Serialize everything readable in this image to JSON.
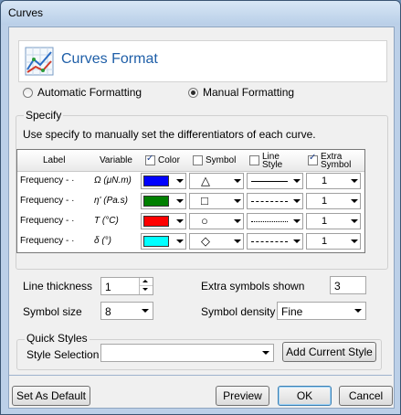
{
  "window": {
    "title": "Curves"
  },
  "header": {
    "title": "Curves Format",
    "icon": "chart-icon"
  },
  "formatting": {
    "automatic_label": "Automatic Formatting",
    "manual_label": "Manual Formatting",
    "selected": "manual"
  },
  "specify": {
    "legend": "Specify",
    "description": "Use specify to manually set the differentiators of each curve.",
    "columns": {
      "label": "Label",
      "variable": "Variable",
      "color": "Color",
      "symbol": "Symbol",
      "line_style": "Line Style",
      "extra_symbol": "Extra Symbol"
    },
    "column_checks": {
      "color": true,
      "symbol": false,
      "line_style": false,
      "extra_symbol": true
    },
    "rows": [
      {
        "label": "Frequency - ·",
        "variable": "Ω  (μN.m)",
        "color": "#0000ff",
        "symbol": "△",
        "line": "solid",
        "extra": "1"
      },
      {
        "label": "Frequency - ·",
        "variable": "η'  (Pa.s)",
        "color": "#008000",
        "symbol": "□",
        "line": "dashed",
        "extra": "1"
      },
      {
        "label": "Frequency - ·",
        "variable": "T  (°C)",
        "color": "#ff0000",
        "symbol": "○",
        "line": "dotted",
        "extra": "1"
      },
      {
        "label": "Frequency - ·",
        "variable": "δ  (°)",
        "color": "#00ffff",
        "symbol": "◇",
        "line": "dashdot",
        "extra": "1"
      }
    ]
  },
  "settings": {
    "line_thickness_label": "Line thickness",
    "line_thickness": "1",
    "extra_symbols_label": "Extra symbols shown",
    "extra_symbols": "3",
    "symbol_size_label": "Symbol size",
    "symbol_size": "8",
    "symbol_density_label": "Symbol density",
    "symbol_density": "Fine"
  },
  "quick_styles": {
    "legend": "Quick Styles",
    "style_selection_label": "Style Selection",
    "style_selection": "",
    "add_button": "Add Current Style"
  },
  "footer": {
    "set_default": "Set As Default",
    "preview": "Preview",
    "ok": "OK",
    "cancel": "Cancel"
  }
}
